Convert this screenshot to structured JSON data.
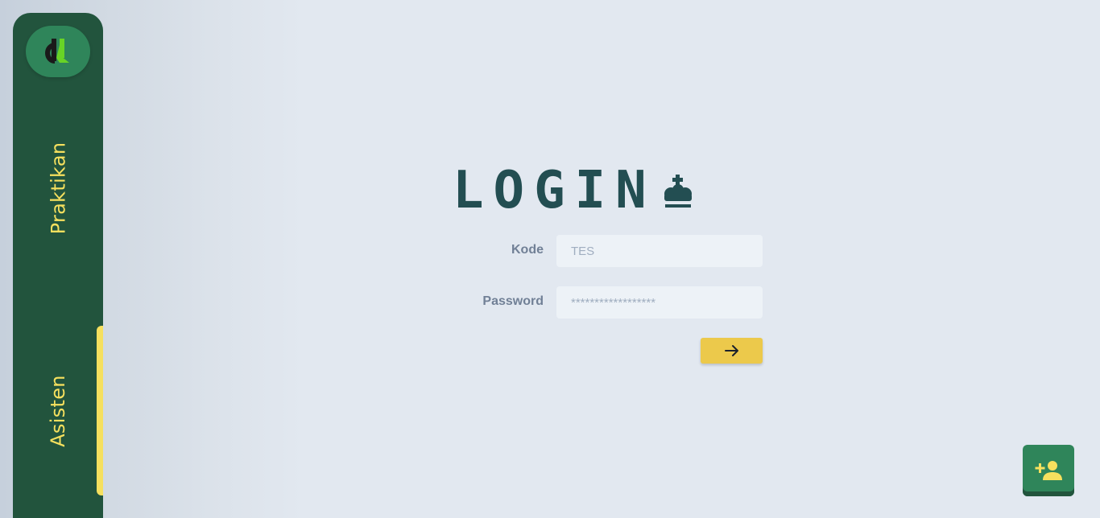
{
  "sidebar": {
    "logo_icon": "app-logo",
    "items": [
      {
        "label": "Praktikan",
        "active": false
      },
      {
        "label": "Asisten",
        "active": true
      }
    ],
    "label_color": "#f6e05e",
    "background": "#22543d"
  },
  "login": {
    "title": "LOGIN",
    "title_icon": "crown-chess-king-icon",
    "kode_label": "Kode",
    "kode_placeholder": "TES",
    "password_label": "Password",
    "password_placeholder": "******************",
    "submit_icon": "arrow-right-icon",
    "submit_color": "#ecc94b"
  },
  "fab": {
    "icon": "user-plus-icon",
    "color": "#2f855a"
  },
  "colors": {
    "title": "#234e52",
    "label": "#718096",
    "input_bg": "#edf2f7"
  }
}
